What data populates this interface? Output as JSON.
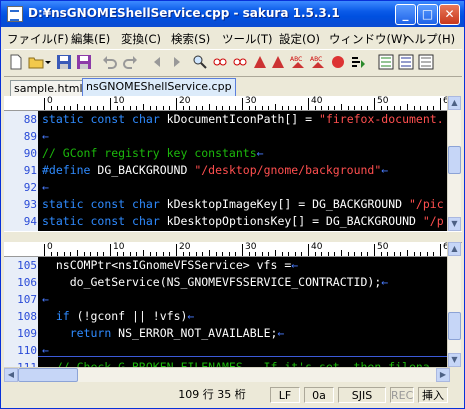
{
  "window": {
    "title": "D:¥nsGNOMEShellService.cpp - sakura 1.5.3.1",
    "min_glyph": "_",
    "max_glyph": "□",
    "close_glyph": "✕"
  },
  "menu": [
    {
      "label": "ファイル(F)"
    },
    {
      "label": "編集(E)"
    },
    {
      "label": "変換(C)"
    },
    {
      "label": "検索(S)"
    },
    {
      "label": "ツール(T)"
    },
    {
      "label": "設定(O)"
    },
    {
      "label": "ウィンドウ(W)"
    },
    {
      "label": "ヘルプ(H)"
    }
  ],
  "tabs": [
    {
      "label": "sample.html"
    },
    {
      "label": "nsGNOMEShellService.cpp"
    }
  ],
  "ruler": {
    "marks_upper": [
      "0",
      "10",
      "20",
      "30",
      "40",
      "50",
      "60",
      "70"
    ],
    "marks_lower": [
      "0",
      "10",
      "20",
      "30",
      "40",
      "50",
      "60",
      "70"
    ]
  },
  "editor_top": {
    "lines": [
      {
        "num": "88",
        "text": "static const char kDocumentIconPath[] = \"firefox-document.",
        "kind": "code"
      },
      {
        "num": "89",
        "text": "←",
        "kind": "blank"
      },
      {
        "num": "90",
        "text": "// GConf registry key constants←",
        "kind": "comment"
      },
      {
        "num": "91",
        "text": "#define DG_BACKGROUND \"/desktop/gnome/background\"←",
        "kind": "define"
      },
      {
        "num": "92",
        "text": "←",
        "kind": "blank"
      },
      {
        "num": "93",
        "text": "static const char kDesktopImageKey[] = DG_BACKGROUND \"/pic",
        "kind": "code"
      },
      {
        "num": "94",
        "text": "static const char kDesktopOptionsKey[] = DG_BACKGROUND \"/p",
        "kind": "code"
      }
    ]
  },
  "editor_bottom": {
    "lines": [
      {
        "num": "105",
        "text": "  nsCOMPtr<nsIGnomeVFSService> vfs =←",
        "kind": "plain"
      },
      {
        "num": "106",
        "text": "    do_GetService(NS_GNOMEVFSSERVICE_CONTRACTID);←",
        "kind": "plain"
      },
      {
        "num": "107",
        "text": "←",
        "kind": "blank"
      },
      {
        "num": "108",
        "text": "  if (!gconf || !vfs)←",
        "kind": "plain"
      },
      {
        "num": "109",
        "text": "    return NS_ERROR_NOT_AVAILABLE;←",
        "kind": "plain"
      },
      {
        "num": "110",
        "text": "←",
        "kind": "cursor"
      },
      {
        "num": "111",
        "text": "  // Check G_BROKEN_FILENAMES.  If it's set, then filena",
        "kind": "comment"
      }
    ]
  },
  "status": {
    "position": "109 行  35 桁",
    "linebreak": "LF",
    "code": "0a",
    "encoding": "SJIS",
    "rec": "REC",
    "mode": "挿入"
  },
  "colors": {
    "keyword": "#2f8bff",
    "string": "#ff4f4f",
    "comment": "#1cb80c",
    "plain": "#ffffff",
    "newline": "#4a7cff",
    "cursorline": "#3c5ad8"
  },
  "toolbar_icons": [
    "new-file-icon",
    "open-folder-icon",
    "dropdown-icon",
    "save-icon",
    "save-all-icon",
    "undo-icon",
    "redo-icon",
    "back-icon",
    "forward-icon",
    "search-icon",
    "search-prev-icon",
    "search-next-icon",
    "replace-icon",
    "bookmark-icon",
    "grep-icon",
    "jump-icon",
    "tag-jump-icon",
    "outline-icon",
    "compare-icon",
    "macro-icon",
    "tool-icon"
  ]
}
